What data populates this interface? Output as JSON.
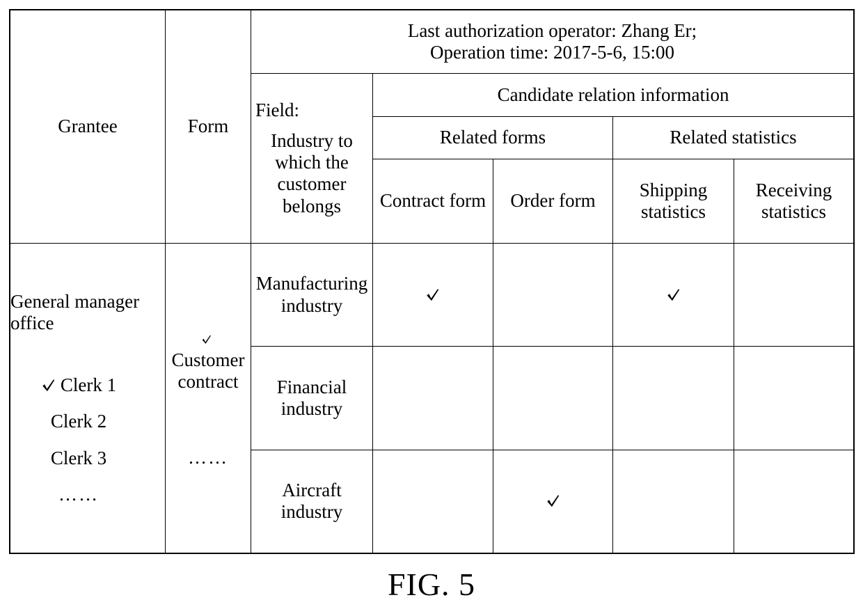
{
  "figure": {
    "caption": "FIG. 5"
  },
  "table": {
    "headers": {
      "grantee": "Grantee",
      "form": "Form",
      "authorization_note_line1": "Last authorization operator: Zhang Er;",
      "authorization_note_line2": "Operation time: 2017-5-6, 15:00",
      "candidate_relation_information": "Candidate relation information",
      "field_label": "Field:",
      "field_value": "Industry to which the customer belongs",
      "related_forms": "Related forms",
      "related_statistics": "Related statistics",
      "contract_form": "Contract form",
      "order_form": "Order form",
      "shipping_statistics": "Shipping statistics",
      "receiving_statistics": "Receiving statistics"
    },
    "grantee": {
      "organization": "General manager office",
      "members": [
        {
          "label": "Clerk 1",
          "checked": true
        },
        {
          "label": "Clerk 2",
          "checked": false
        },
        {
          "label": "Clerk 3",
          "checked": false
        }
      ],
      "ellipsis": "……"
    },
    "form": {
      "name": "Customer contract",
      "checked": true,
      "ellipsis": "……"
    },
    "rows": [
      {
        "industry": "Manufacturing industry",
        "contract_form": true,
        "order_form": false,
        "shipping_statistics": true,
        "receiving_statistics": false
      },
      {
        "industry": "Financial industry",
        "contract_form": false,
        "order_form": false,
        "shipping_statistics": false,
        "receiving_statistics": false
      },
      {
        "industry": "Aircraft industry",
        "contract_form": false,
        "order_form": true,
        "shipping_statistics": false,
        "receiving_statistics": false
      }
    ],
    "icons": {
      "check": "check-mark-icon"
    },
    "colors": {
      "border": "#000000",
      "text": "#000000",
      "background": "#ffffff"
    }
  }
}
